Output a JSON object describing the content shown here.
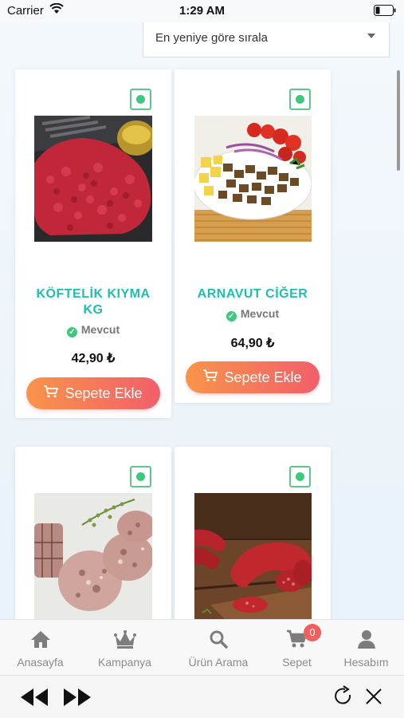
{
  "status_bar": {
    "carrier": "Carrier",
    "time": "1:29 AM"
  },
  "sort": {
    "selected": "En yeniye göre sırala"
  },
  "products": [
    {
      "name": "KÖFTELİK KIYMA KG",
      "stock": "Mevcut",
      "price": "42,90 ₺",
      "button": "Sepete Ekle",
      "image": "minced-meat"
    },
    {
      "name": "ARNAVUT CİĞER",
      "stock": "Mevcut",
      "price": "64,90 ₺",
      "button": "Sepete Ekle",
      "image": "albanian-liver"
    },
    {
      "name": "",
      "image": "head-cheese"
    },
    {
      "name": "",
      "image": "sausage"
    }
  ],
  "tabs": [
    {
      "label": "Anasayfa",
      "icon": "home-icon"
    },
    {
      "label": "Kampanya",
      "icon": "crown-icon"
    },
    {
      "label": "Ürün Arama",
      "icon": "search-icon"
    },
    {
      "label": "Sepet",
      "icon": "cart-icon",
      "badge": "0"
    },
    {
      "label": "Hesabım",
      "icon": "user-icon"
    }
  ],
  "colors": {
    "accent": "#1fbdb3",
    "button_start": "#f8944a",
    "button_end": "#f25f6a",
    "available": "#3dc97d"
  }
}
